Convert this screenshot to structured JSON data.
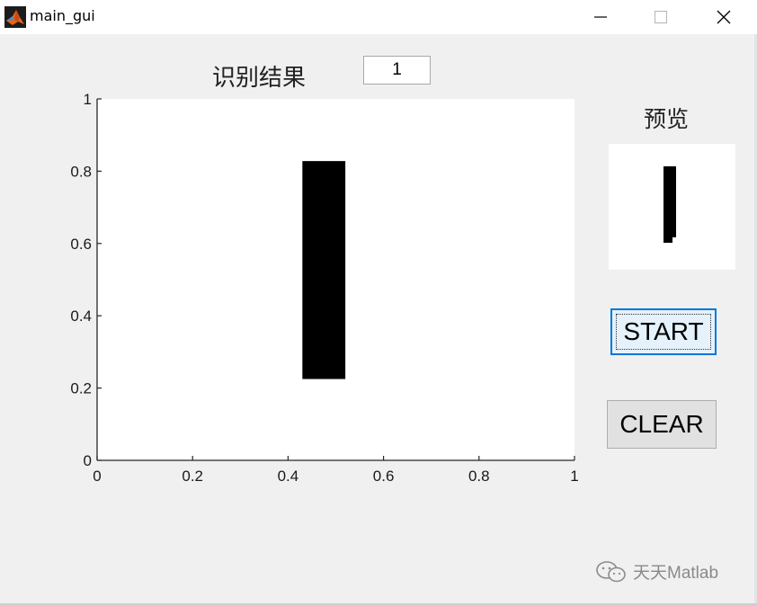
{
  "window": {
    "title": "main_gui",
    "controls": [
      "minimize",
      "maximize",
      "close"
    ]
  },
  "result": {
    "label": "识别结果",
    "value": "1"
  },
  "axes": {
    "xlim": [
      0,
      1
    ],
    "ylim": [
      0,
      1
    ],
    "x_ticks": [
      "0",
      "0.2",
      "0.4",
      "0.6",
      "0.8",
      "1"
    ],
    "y_ticks": [
      "0",
      "0.2",
      "0.4",
      "0.6",
      "0.8",
      "1"
    ],
    "stroke": {
      "x": [
        0.43,
        0.52
      ],
      "y": [
        0.225,
        0.828
      ]
    }
  },
  "preview": {
    "label": "预览"
  },
  "buttons": {
    "start": "START",
    "clear": "CLEAR"
  },
  "watermark": {
    "text": "天天Matlab"
  },
  "colors": {
    "background": "#f0f0f0",
    "start_border": "#0078d7",
    "start_fill": "#e5f1fb",
    "clear_fill": "#e1e1e1"
  }
}
